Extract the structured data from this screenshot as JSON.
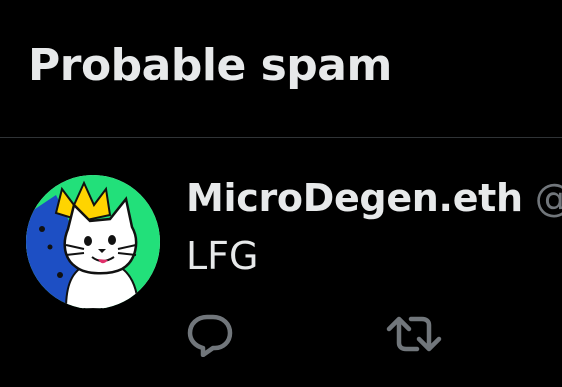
{
  "section": {
    "title": "Probable spam"
  },
  "tweet": {
    "author_name": "MicroDegen.eth",
    "author_handle": "@",
    "text": "LFG",
    "actions": {
      "reply_icon": "reply-icon",
      "retweet_icon": "retweet-icon"
    }
  },
  "colors": {
    "background": "#000000",
    "primary_text": "#e7e9ea",
    "secondary_text": "#71767b",
    "divider": "#2f3336",
    "avatar_bg": "#22e07a"
  }
}
